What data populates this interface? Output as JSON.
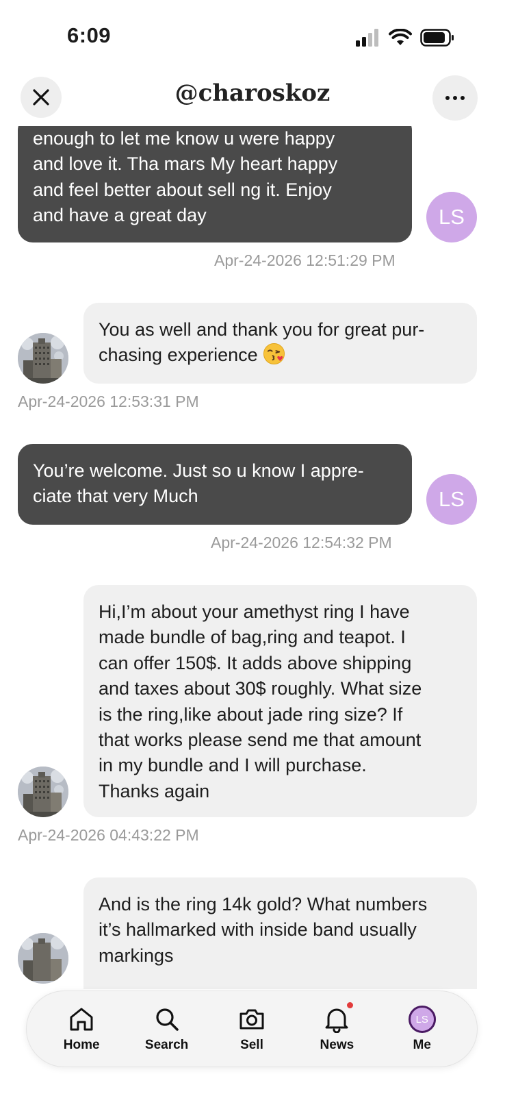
{
  "status_bar": {
    "time": "6:09"
  },
  "header": {
    "title": "@charoskoz",
    "close_icon": "close-icon",
    "more_icon": "more-icon"
  },
  "messages": [
    {
      "direction": "outgoing",
      "text": "enough to let me know u were happy\nand love it. Tha mars My heart happy\nand feel better about sell ng it. Enjoy\nand have a great day",
      "timestamp": "Apr-24-2026 12:51:29 PM",
      "avatar": "LS"
    },
    {
      "direction": "incoming",
      "text": "You as well and thank you for great pur-\nchasing experience",
      "emoji": "kissing-face-emoji",
      "timestamp": "Apr-24-2026 12:53:31 PM"
    },
    {
      "direction": "outgoing",
      "text": "You’re welcome. Just so u know I appre-\nciate that very Much",
      "timestamp": "Apr-24-2026 12:54:32 PM",
      "avatar": "LS"
    },
    {
      "direction": "incoming",
      "text": "Hi,I’m about your amethyst ring I have\nmade bundle of bag,ring and teapot. I\ncan offer 150$. It adds above shipping\nand taxes about 30$ roughly. What size\nis the ring,like about jade ring size? If\nthat works please send me that amount\nin my bundle and I will purchase.\nThanks again",
      "timestamp": "Apr-24-2026 04:43:22 PM"
    },
    {
      "direction": "incoming",
      "text": "And is the ring 14k gold? What numbers\nit’s hallmarked with inside band usually\nmarkings",
      "timestamp": ""
    }
  ],
  "tabbar": {
    "items": [
      {
        "label": "Home",
        "icon": "home-icon"
      },
      {
        "label": "Search",
        "icon": "search-icon"
      },
      {
        "label": "Sell",
        "icon": "camera-icon"
      },
      {
        "label": "News",
        "icon": "bell-icon",
        "badge": true
      },
      {
        "label": "Me",
        "icon": "avatar",
        "avatar_text": "LS"
      }
    ]
  },
  "colors": {
    "outgoing_bubble": "#4a4a4a",
    "incoming_bubble": "#f0f0f0",
    "avatar_ls": "#cfa8e8",
    "timestamp": "#9a9a9a",
    "badge": "#e23b3b"
  }
}
